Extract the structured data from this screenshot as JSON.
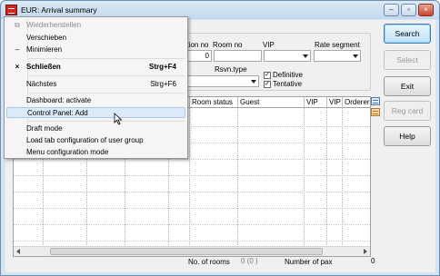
{
  "window": {
    "title": "EUR: Arrival summary",
    "controls": [
      "minimize",
      "restore",
      "close"
    ]
  },
  "filters": {
    "labels": {
      "station_no_partial": "ation no",
      "room_no": "Room no",
      "vip": "VIP",
      "rate_segment": "Rate segment",
      "rsvn_type": "Rsvn.type",
      "definitive": "Definitive",
      "tentative": "Tentative"
    },
    "station_no_value": "0",
    "room_no_value": "",
    "definitive_checked": true,
    "tentative_checked": true
  },
  "grid": {
    "columns": [
      "Room status",
      "Guest",
      "VIP",
      "VIP",
      "Orderer"
    ]
  },
  "buttons": {
    "search": "Search",
    "select": "Select",
    "exit": "Exit",
    "reg_card": "Reg card",
    "help": "Help"
  },
  "status": {
    "rooms_label": "No. of rooms",
    "rooms_value": "0 (0 )",
    "pax_label": "Number of pax",
    "pax_value": "0"
  },
  "context_menu": {
    "items": [
      {
        "icon": "restore-icon",
        "label": "Wiederherstellen",
        "key": "",
        "state": "disabled"
      },
      {
        "icon": "",
        "label": "Verschieben",
        "key": "",
        "state": "normal"
      },
      {
        "icon": "minimize-icon",
        "label": "Minimieren",
        "key": "",
        "state": "normal"
      },
      {
        "icon": "close-icon",
        "label": "Schließen",
        "key": "Strg+F4",
        "state": "bold"
      },
      {
        "icon": "",
        "label": "Nächstes",
        "key": "Strg+F6",
        "state": "normal"
      },
      {
        "icon": "",
        "label": "Dashboard: activate",
        "key": "",
        "state": "normal"
      },
      {
        "icon": "",
        "label": "Control Panel: Add",
        "key": "",
        "state": "hover"
      },
      {
        "icon": "",
        "label": "Draft mode",
        "key": "",
        "state": "normal"
      },
      {
        "icon": "",
        "label": "Load tab configuration of user group",
        "key": "",
        "state": "normal"
      },
      {
        "icon": "",
        "label": "Menu configuration mode",
        "key": "",
        "state": "normal"
      }
    ],
    "icon_glyphs": {
      "restore-icon": "⧉",
      "minimize-icon": "–",
      "close-icon": "×"
    }
  }
}
